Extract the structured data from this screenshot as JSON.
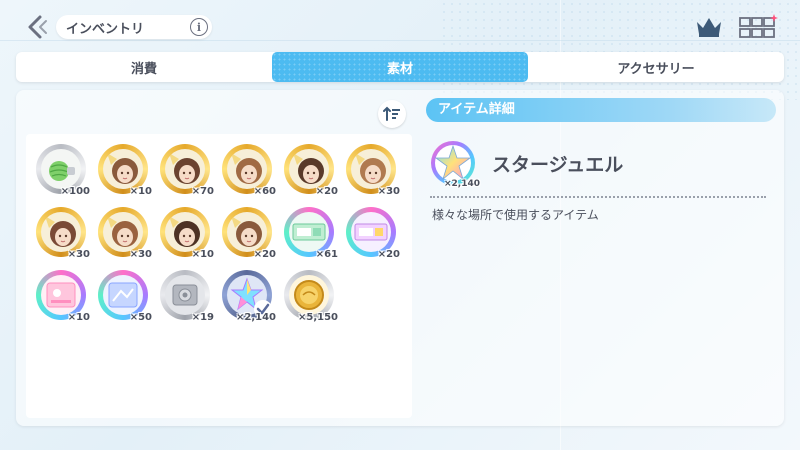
{
  "header": {
    "title": "インベントリ",
    "info_icon": "info-icon",
    "back_icon": "back-arrow-icon"
  },
  "tabs": [
    {
      "label": "消費",
      "active": false
    },
    {
      "label": "素材",
      "active": true
    },
    {
      "label": "アクセサリー",
      "active": false
    }
  ],
  "inventory": {
    "items": [
      {
        "name": "melon",
        "ring": "silver",
        "count": "×100"
      },
      {
        "name": "character-piece-1",
        "ring": "gold",
        "count": "×10"
      },
      {
        "name": "character-piece-2",
        "ring": "gold",
        "count": "×70"
      },
      {
        "name": "character-piece-3",
        "ring": "gold",
        "count": "×60"
      },
      {
        "name": "character-piece-4",
        "ring": "gold",
        "count": "×20"
      },
      {
        "name": "character-piece-5",
        "ring": "gold",
        "count": "×30"
      },
      {
        "name": "character-piece-6",
        "ring": "gold",
        "count": "×30"
      },
      {
        "name": "character-piece-7",
        "ring": "gold",
        "count": "×30"
      },
      {
        "name": "character-piece-8",
        "ring": "gold",
        "count": "×10"
      },
      {
        "name": "character-piece-9",
        "ring": "gold",
        "count": "×20"
      },
      {
        "name": "ticket-green",
        "ring": "rainbow",
        "count": "×61"
      },
      {
        "name": "ticket-purple",
        "ring": "rainbow",
        "count": "×20"
      },
      {
        "name": "card-pink",
        "ring": "rainbow",
        "count": "×10"
      },
      {
        "name": "card-blue",
        "ring": "rainbow",
        "count": "×50"
      },
      {
        "name": "silver-coin-pouch",
        "ring": "silver",
        "count": "×19"
      },
      {
        "name": "star-jewel",
        "ring": "dark",
        "count": "×2,140",
        "selected": true
      },
      {
        "name": "gold-coin",
        "ring": "silver",
        "count": "×5,150"
      }
    ]
  },
  "detail": {
    "header": "アイテム詳細",
    "name": "スタージュエル",
    "count": "×2,140",
    "description": "様々な場所で使用するアイテム"
  },
  "colors": {
    "accent": "#4dbbf1",
    "text": "#4a4f5c",
    "gold": "#e6a92b"
  }
}
